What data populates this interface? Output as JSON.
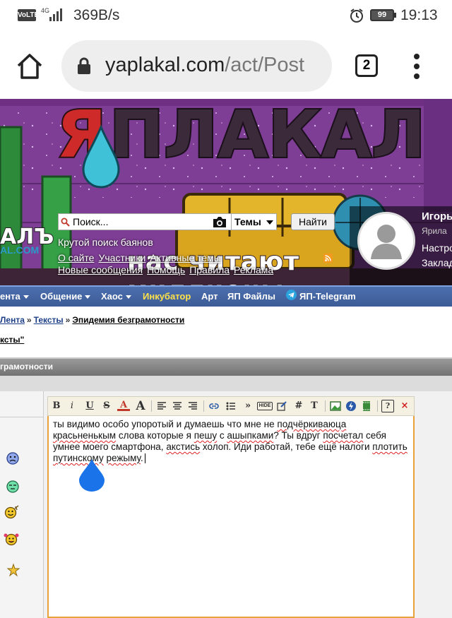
{
  "status_bar": {
    "volte": "VoLTE",
    "network": "4G",
    "speed": "369B/s",
    "battery": "99",
    "time": "19:13"
  },
  "browser": {
    "url_domain": "yaplakal.com",
    "url_path": "/act/Post",
    "tab_count": "2"
  },
  "banner": {
    "slogan": "нас читают миллионы",
    "logo_text": "АЛЪ",
    "logo_sub": "AL.COM",
    "search_placeholder": "Поиск...",
    "search_scope": "Темы",
    "search_button": "Найти",
    "tagline": "Крутой поиск баянов",
    "links_row1": [
      "О сайте",
      "Участники",
      "Активные темы"
    ],
    "links_row2": [
      "Новые сообщения",
      "Помощь",
      "Правила",
      "Реклама"
    ]
  },
  "user": {
    "name": "Игорь",
    "rank": "Ярила",
    "link1": "Настро",
    "link2": "Заклад"
  },
  "nav": {
    "items": [
      {
        "label": "ента",
        "dropdown": true
      },
      {
        "label": "Общение",
        "dropdown": true
      },
      {
        "label": "Хаос",
        "dropdown": true
      },
      {
        "label": "Инкубатор",
        "dropdown": false,
        "highlight": true
      },
      {
        "label": "Арт",
        "dropdown": false
      },
      {
        "label": "ЯП Файлы",
        "dropdown": false
      },
      {
        "label": "ЯП-Telegram",
        "dropdown": false
      }
    ]
  },
  "breadcrumb": {
    "items": [
      "Лента",
      "Тексты",
      "Эпидемия безграмотности"
    ],
    "separator": "»",
    "topic_link": "ксты\""
  },
  "section_title": "грамотности",
  "editor": {
    "toolbar": [
      "B",
      "i",
      "U",
      "S",
      "A",
      "A",
      "align-left",
      "align-center",
      "align-right",
      "link",
      "list",
      "»",
      "HIDE",
      "edit",
      "#",
      "T",
      "image",
      "flash",
      "video",
      "?",
      "×"
    ],
    "text_parts": [
      {
        "t": "ты видимо особо упоротый и думаешь что мне не ",
        "e": false
      },
      {
        "t": "подчёркиваюца",
        "e": true
      },
      {
        "t": " ",
        "e": false
      },
      {
        "t": "красьненькым",
        "e": true
      },
      {
        "t": " слова которые я ",
        "e": false
      },
      {
        "t": "пешу",
        "e": true
      },
      {
        "t": " с ",
        "e": false
      },
      {
        "t": "ашыпками",
        "e": true
      },
      {
        "t": "? Ты вдруг ",
        "e": false
      },
      {
        "t": "посчетал",
        "e": true
      },
      {
        "t": " себя умнее моего смартфона, ",
        "e": false
      },
      {
        "t": "акстись",
        "e": true
      },
      {
        "t": " холоп. Иди работай, тебе ещё налоги ",
        "e": false
      },
      {
        "t": "плотить",
        "e": true
      },
      {
        "t": "  ",
        "e": false
      },
      {
        "t": "путинскому",
        "e": true
      },
      {
        "t": " ",
        "e": false
      },
      {
        "t": "режыму",
        "e": true
      },
      {
        "t": ".",
        "e": false
      }
    ]
  },
  "colors": {
    "nav_bg": "#4464a3",
    "nav_highlight": "#ffe14a",
    "editor_border": "#e9a23b",
    "spellcheck": "#e02020",
    "link": "#1d3f88"
  }
}
